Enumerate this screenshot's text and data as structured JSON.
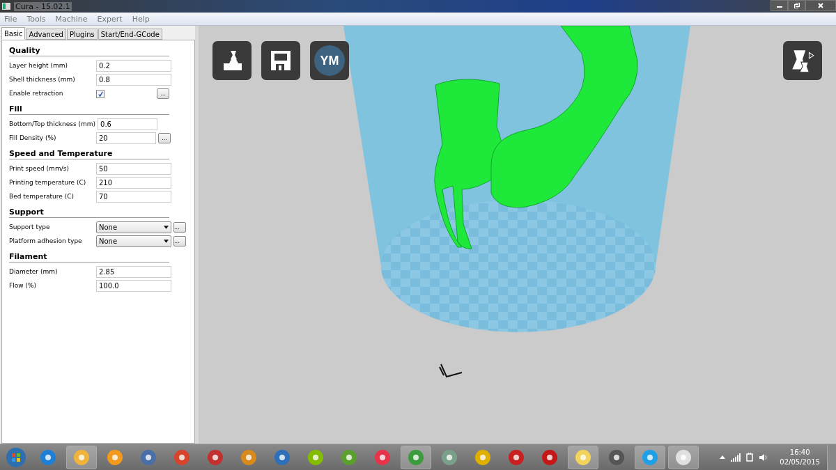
{
  "window": {
    "title": "Cura - 15.02.1"
  },
  "menu": [
    "File",
    "Tools",
    "Machine",
    "Expert",
    "Help"
  ],
  "tabs": [
    {
      "label": "Basic",
      "selected": true
    },
    {
      "label": "Advanced",
      "selected": false
    },
    {
      "label": "Plugins",
      "selected": false
    },
    {
      "label": "Start/End-GCode",
      "selected": false
    }
  ],
  "sections": [
    {
      "title": "Quality",
      "fields": [
        {
          "kind": "text",
          "label": "Layer height (mm)",
          "value": "0.2"
        },
        {
          "kind": "text",
          "label": "Shell thickness (mm)",
          "value": "0.8"
        },
        {
          "kind": "checkbox",
          "label": "Enable retraction",
          "checked": true,
          "button": "..."
        }
      ]
    },
    {
      "title": "Fill",
      "fields": [
        {
          "kind": "text",
          "label": "Bottom/Top thickness (mm)",
          "value": "0.6"
        },
        {
          "kind": "text",
          "label": "Fill Density (%)",
          "value": "20",
          "button": "..."
        }
      ]
    },
    {
      "title": "Speed and Temperature",
      "fields": [
        {
          "kind": "text",
          "label": "Print speed (mm/s)",
          "value": "50"
        },
        {
          "kind": "text",
          "label": "Printing temperature (C)",
          "value": "210"
        },
        {
          "kind": "text",
          "label": "Bed temperature (C)",
          "value": "70"
        }
      ]
    },
    {
      "title": "Support",
      "fields": [
        {
          "kind": "select",
          "label": "Support type",
          "value": "None",
          "button": "..."
        },
        {
          "kind": "select",
          "label": "Platform adhesion type",
          "value": "None",
          "button": "..."
        }
      ]
    },
    {
      "title": "Filament",
      "fields": [
        {
          "kind": "text",
          "label": "Diameter (mm)",
          "value": "2.85"
        },
        {
          "kind": "text",
          "label": "Flow (%)",
          "value": "100.0"
        }
      ]
    }
  ],
  "toolbar": {
    "account_initials": "YM"
  },
  "taskbar": {
    "apps": [
      {
        "open": false
      },
      {
        "open": true
      },
      {
        "open": false
      },
      {
        "open": false
      },
      {
        "open": false
      },
      {
        "open": false
      },
      {
        "open": false
      },
      {
        "open": false
      },
      {
        "open": false
      },
      {
        "open": false
      },
      {
        "open": false
      },
      {
        "open": true
      },
      {
        "open": false
      },
      {
        "open": false
      },
      {
        "open": false
      },
      {
        "open": false
      },
      {
        "open": true
      },
      {
        "open": false
      },
      {
        "open": true
      },
      {
        "open": true
      }
    ],
    "time": "16:40",
    "date": "02/05/2015"
  }
}
